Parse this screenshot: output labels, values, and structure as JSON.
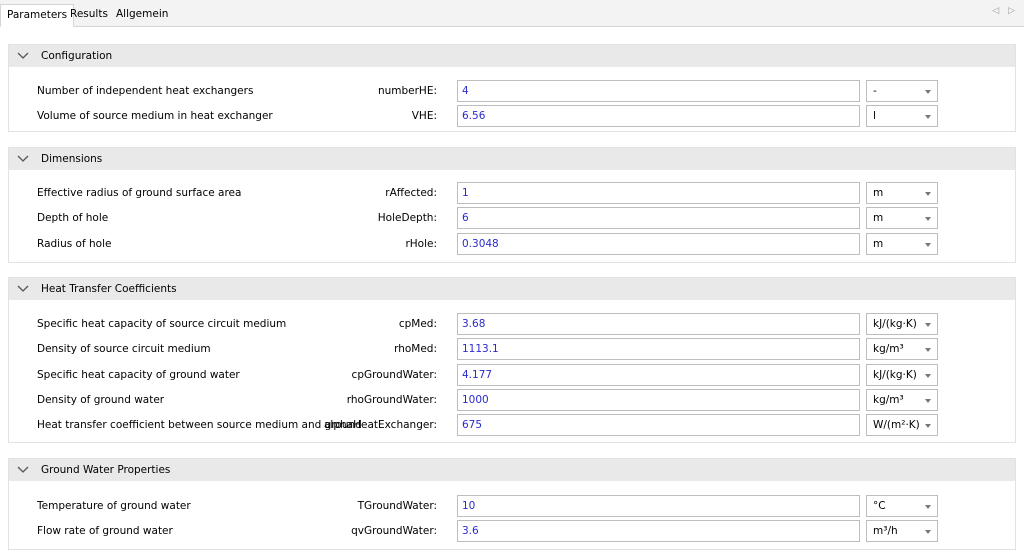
{
  "tabs": [
    {
      "label": "Parameters",
      "active": true
    },
    {
      "label": "Results",
      "active": false
    },
    {
      "label": "Allgemein",
      "active": false
    }
  ],
  "tab_nav": "◁ ▷",
  "sections": [
    {
      "title": "Configuration",
      "rows": [
        {
          "description": "Number of independent heat exchangers",
          "param": "numberHE:",
          "value": "4",
          "unit": "-"
        },
        {
          "description": "Volume of source medium in heat exchanger",
          "param": "VHE:",
          "value": "6.56",
          "unit": "l"
        }
      ]
    },
    {
      "title": "Dimensions",
      "rows": [
        {
          "description": "Effective radius of ground surface area",
          "param": "rAffected:",
          "value": "1",
          "unit": "m"
        },
        {
          "description": "Depth of hole",
          "param": "HoleDepth:",
          "value": "6",
          "unit": "m"
        },
        {
          "description": "Radius of hole",
          "param": "rHole:",
          "value": "0.3048",
          "unit": "m"
        }
      ]
    },
    {
      "title": "Heat Transfer Coefficients",
      "rows": [
        {
          "description": "Specific heat capacity of source circuit medium",
          "param": "cpMed:",
          "value": "3.68",
          "unit": "kJ/(kg·K)"
        },
        {
          "description": "Density of source circuit medium",
          "param": "rhoMed:",
          "value": "1113.1",
          "unit": "kg/m³"
        },
        {
          "description": "Specific heat capacity of ground water",
          "param": "cpGroundWater:",
          "value": "4.177",
          "unit": "kJ/(kg·K)"
        },
        {
          "description": "Density of ground water",
          "param": "rhoGroundWater:",
          "value": "1000",
          "unit": "kg/m³"
        },
        {
          "description": "Heat transfer coefficient between source medium and ground",
          "param": "alphaHeatExchanger:",
          "value": "675",
          "unit": "W/(m²·K)"
        }
      ]
    },
    {
      "title": "Ground Water Properties",
      "rows": [
        {
          "description": "Temperature of ground water",
          "param": "TGroundWater:",
          "value": "10",
          "unit": "°C"
        },
        {
          "description": "Flow rate of ground water",
          "param": "qvGroundWater:",
          "value": "3.6",
          "unit": "m³/h"
        }
      ]
    }
  ]
}
